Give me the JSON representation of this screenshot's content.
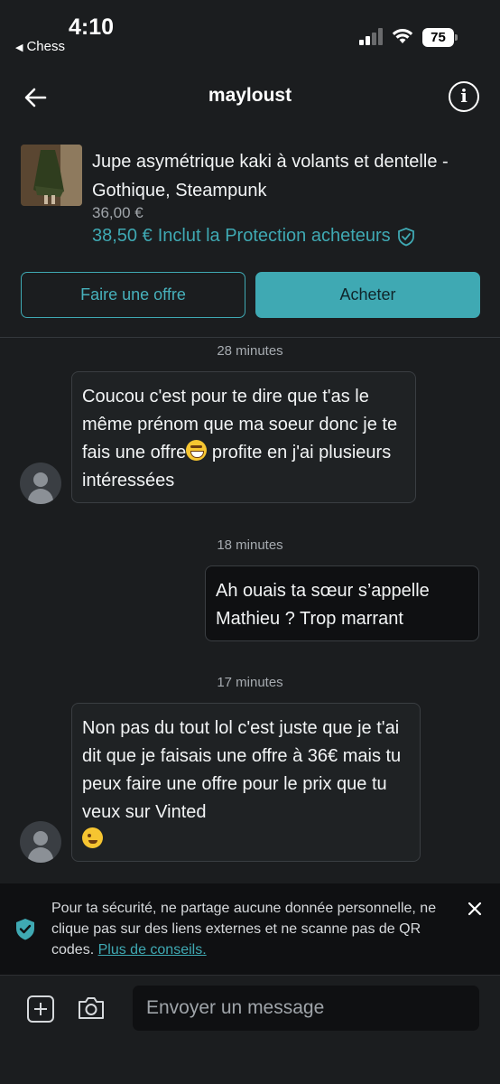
{
  "status_bar": {
    "time": "4:10",
    "back_app": "Chess",
    "battery": "75"
  },
  "header": {
    "title": "mayloust"
  },
  "item": {
    "title": "Jupe asymétrique kaki à volants et dentelle - Gothique, Steampunk",
    "price": "36,00 €",
    "total_price": "38,50 €",
    "protection_label": "Inclut la Protection acheteurs"
  },
  "actions": {
    "offer_label": "Faire une offre",
    "buy_label": "Acheter"
  },
  "messages": [
    {
      "timestamp": "28 minutes",
      "direction": "incoming",
      "text_before_emoji": "Coucou c'est pour te dire que t'as le même prénom que ma soeur donc je te fais une offre",
      "emoji": "grinning-face",
      "text_after_emoji": " profite en j'ai plusieurs intéressées"
    },
    {
      "timestamp": "18 minutes",
      "direction": "outgoing",
      "text": "Ah ouais ta sœur s’appelle Mathieu ? Trop marrant"
    },
    {
      "timestamp": "17 minutes",
      "direction": "incoming",
      "text": "Non pas du tout lol c'est juste que je t'ai dit que je faisais une offre à 36€ mais tu peux faire une offre pour le prix que tu veux sur Vinted",
      "emoji": "winking-face"
    }
  ],
  "safety_notice": {
    "text": "Pour ta sécurité, ne partage aucune donnée personnelle, ne clique pas sur des liens externes et ne scanne pas de QR codes.",
    "link": "Plus de conseils."
  },
  "composer": {
    "placeholder": "Envoyer un message"
  },
  "colors": {
    "accent": "#3fa9b3",
    "background": "#1b1d1f"
  }
}
